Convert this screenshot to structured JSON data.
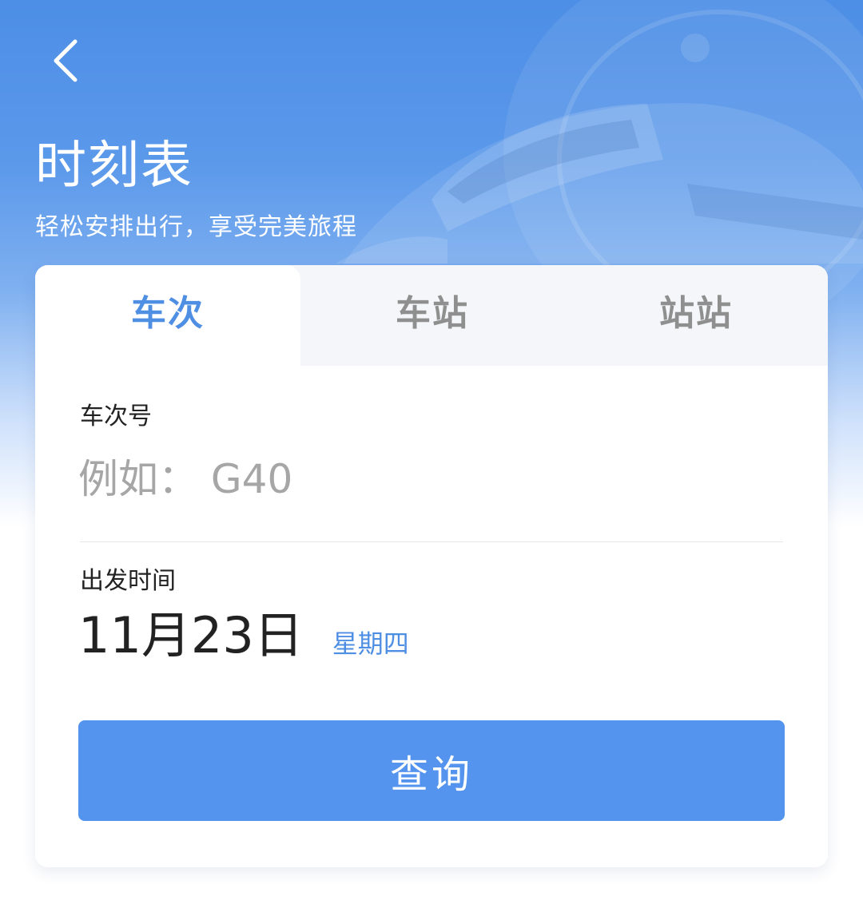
{
  "header": {
    "back_icon": "chevron-left-icon",
    "title": "时刻表",
    "subtitle": "轻松安排出行，享受完美旅程"
  },
  "tabs": [
    {
      "label": "车次",
      "active": true
    },
    {
      "label": "车站",
      "active": false
    },
    {
      "label": "站站",
      "active": false
    }
  ],
  "form": {
    "train_number": {
      "label": "车次号",
      "value": "",
      "placeholder": "例如： G40"
    },
    "departure": {
      "label": "出发时间",
      "date": "11月23日",
      "weekday": "星期四"
    },
    "query_label": "查询"
  },
  "colors": {
    "accent": "#4f8fe3",
    "button": "#5494ee",
    "hero_top": "#4d8ee6"
  }
}
